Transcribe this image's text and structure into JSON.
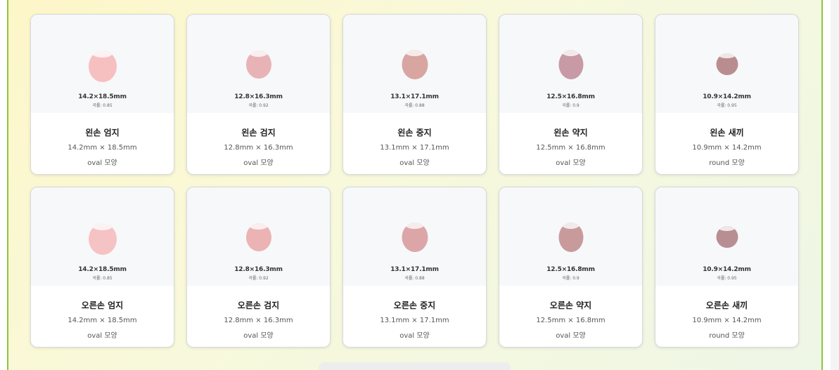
{
  "rows": [
    {
      "cards": [
        {
          "dim_label": "14.2×18.5mm",
          "curvature_label": "곡률: 0.85",
          "name": "왼손 엄지",
          "size_label": "14.2mm × 18.5mm",
          "shape_label": "oval 모양",
          "color": "#f5c0bf"
        },
        {
          "dim_label": "12.8×16.3mm",
          "curvature_label": "곡률: 0.92",
          "name": "왼손 검지",
          "size_label": "12.8mm × 16.3mm",
          "shape_label": "oval 모양",
          "color": "#e8b3b7"
        },
        {
          "dim_label": "13.1×17.1mm",
          "curvature_label": "곡률: 0.88",
          "name": "왼손 중지",
          "size_label": "13.1mm × 17.1mm",
          "shape_label": "oval 모양",
          "color": "#d9a5a0"
        },
        {
          "dim_label": "12.5×16.8mm",
          "curvature_label": "곡률: 0.9",
          "name": "왼손 약지",
          "size_label": "12.5mm × 16.8mm",
          "shape_label": "oval 모양",
          "color": "#c79aa6"
        },
        {
          "dim_label": "10.9×14.2mm",
          "curvature_label": "곡률: 0.95",
          "name": "왼손 새끼",
          "size_label": "10.9mm × 14.2mm",
          "shape_label": "round 모양",
          "color": "#b98d8f"
        }
      ]
    },
    {
      "cards": [
        {
          "dim_label": "14.2×18.5mm",
          "curvature_label": "곡률: 0.85",
          "name": "오른손 엄지",
          "size_label": "14.2mm × 18.5mm",
          "shape_label": "oval 모양",
          "color": "#f5c3c3"
        },
        {
          "dim_label": "12.8×16.3mm",
          "curvature_label": "곡률: 0.92",
          "name": "오른손 검지",
          "size_label": "12.8mm × 16.3mm",
          "shape_label": "oval 모양",
          "color": "#ebb3b3"
        },
        {
          "dim_label": "13.1×17.1mm",
          "curvature_label": "곡률: 0.88",
          "name": "오른손 중지",
          "size_label": "13.1mm × 17.1mm",
          "shape_label": "oval 모양",
          "color": "#dca6a8"
        },
        {
          "dim_label": "12.5×16.8mm",
          "curvature_label": "곡률: 0.9",
          "name": "오른손 약지",
          "size_label": "12.5mm × 16.8mm",
          "shape_label": "oval 모양",
          "color": "#c99a9c"
        },
        {
          "dim_label": "10.9×14.2mm",
          "curvature_label": "곡률: 0.95",
          "name": "오른손 새끼",
          "size_label": "10.9mm × 14.2mm",
          "shape_label": "round 모양",
          "color": "#b88e92"
        }
      ]
    }
  ]
}
